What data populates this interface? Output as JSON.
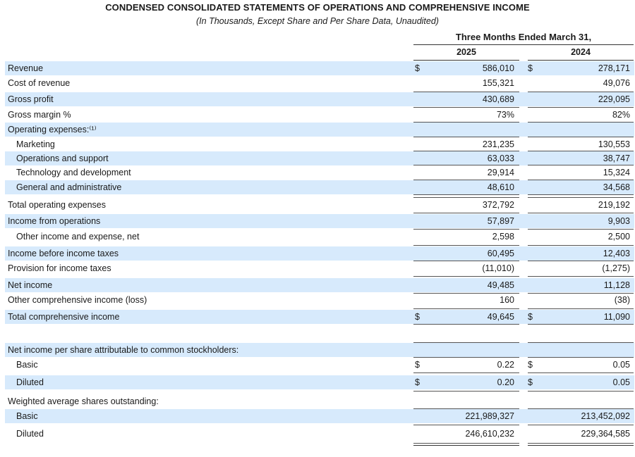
{
  "header": {
    "title": "CONDENSED CONSOLIDATED STATEMENTS OF OPERATIONS AND COMPREHENSIVE INCOME",
    "subtitle": "(In Thousands, Except Share and Per Share Data, Unaudited)",
    "period": "Three Months Ended March 31,",
    "year1": "2025",
    "year2": "2024"
  },
  "rows": [
    {
      "label": "Revenue",
      "cur": "$",
      "v1": "586,010",
      "v2": "278,171",
      "shade": true,
      "indent": false
    },
    {
      "label": "Cost of revenue",
      "cur": "",
      "v1": "155,321",
      "v2": "49,076",
      "shade": false,
      "indent": false
    },
    {
      "label": "Gross profit",
      "cur": "",
      "v1": "430,689",
      "v2": "229,095",
      "shade": true,
      "indent": false
    },
    {
      "label": "Gross margin %",
      "cur": "",
      "v1": "73%",
      "v2": "82%",
      "shade": false,
      "indent": false
    },
    {
      "label": "Operating expenses:⁽¹⁾",
      "cur": "",
      "v1": "",
      "v2": "",
      "shade": true,
      "indent": false
    },
    {
      "label": "Marketing",
      "cur": "",
      "v1": "231,235",
      "v2": "130,553",
      "shade": false,
      "indent": true
    },
    {
      "label": "Operations and support",
      "cur": "",
      "v1": "63,033",
      "v2": "38,747",
      "shade": true,
      "indent": true
    },
    {
      "label": "Technology and development",
      "cur": "",
      "v1": "29,914",
      "v2": "15,324",
      "shade": false,
      "indent": true
    },
    {
      "label": "General and administrative",
      "cur": "",
      "v1": "48,610",
      "v2": "34,568",
      "shade": true,
      "indent": true
    },
    {
      "label": "Total operating expenses",
      "cur": "",
      "v1": "372,792",
      "v2": "219,192",
      "shade": false,
      "indent": false
    },
    {
      "label": "Income from operations",
      "cur": "",
      "v1": "57,897",
      "v2": "9,903",
      "shade": true,
      "indent": false
    },
    {
      "label": "Other income and expense, net",
      "cur": "",
      "v1": "2,598",
      "v2": "2,500",
      "shade": false,
      "indent": true
    },
    {
      "label": "Income before income taxes",
      "cur": "",
      "v1": "60,495",
      "v2": "12,403",
      "shade": true,
      "indent": false
    },
    {
      "label": "Provision for income taxes",
      "cur": "",
      "v1": "(11,010)",
      "v2": "(1,275)",
      "shade": false,
      "indent": false
    },
    {
      "label": "Net income",
      "cur": "",
      "v1": "49,485",
      "v2": "11,128",
      "shade": true,
      "indent": false
    },
    {
      "label": "Other comprehensive income (loss)",
      "cur": "",
      "v1": "160",
      "v2": "(38)",
      "shade": false,
      "indent": false
    },
    {
      "label": "Total comprehensive income",
      "cur": "$",
      "v1": "49,645",
      "v2": "11,090",
      "shade": true,
      "indent": false
    },
    {
      "label": "Net income per share attributable to common stockholders:",
      "cur": "",
      "v1": "",
      "v2": "",
      "shade": true,
      "indent": false
    },
    {
      "label": "Basic",
      "cur": "$",
      "v1": "0.22",
      "v2": "0.05",
      "shade": false,
      "indent": true
    },
    {
      "label": "Diluted",
      "cur": "$",
      "v1": "0.20",
      "v2": "0.05",
      "shade": true,
      "indent": true
    },
    {
      "label": "Weighted average shares outstanding:",
      "cur": "",
      "v1": "",
      "v2": "",
      "shade": false,
      "indent": false
    },
    {
      "label": "Basic",
      "cur": "",
      "v1": "221,989,327",
      "v2": "213,452,092",
      "shade": true,
      "indent": true
    },
    {
      "label": "Diluted",
      "cur": "",
      "v1": "246,610,232",
      "v2": "229,364,585",
      "shade": false,
      "indent": true
    }
  ]
}
